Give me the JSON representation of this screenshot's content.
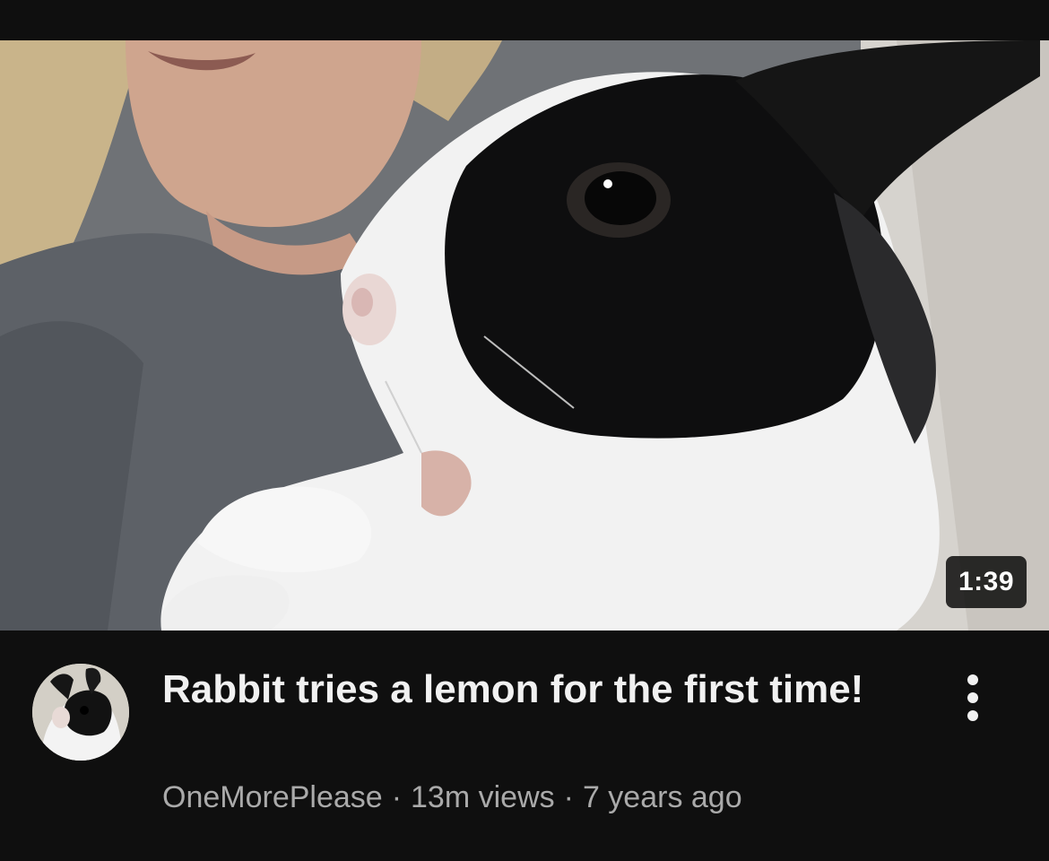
{
  "video": {
    "duration": "1:39",
    "title": "Rabbit tries a lemon for the first time!",
    "channel": "OneMorePlease",
    "views": "13m views",
    "age": "7 years ago",
    "separator": "·",
    "thumbnail_icon": "rabbit-thumbnail-image",
    "avatar_icon": "rabbit-avatar-image",
    "more_icon": "more-vertical-icon"
  },
  "colors": {
    "background": "#0f0f0f",
    "title_text": "#f1f1f1",
    "secondary_text": "#aaaaaa",
    "badge_background": "#000000"
  }
}
